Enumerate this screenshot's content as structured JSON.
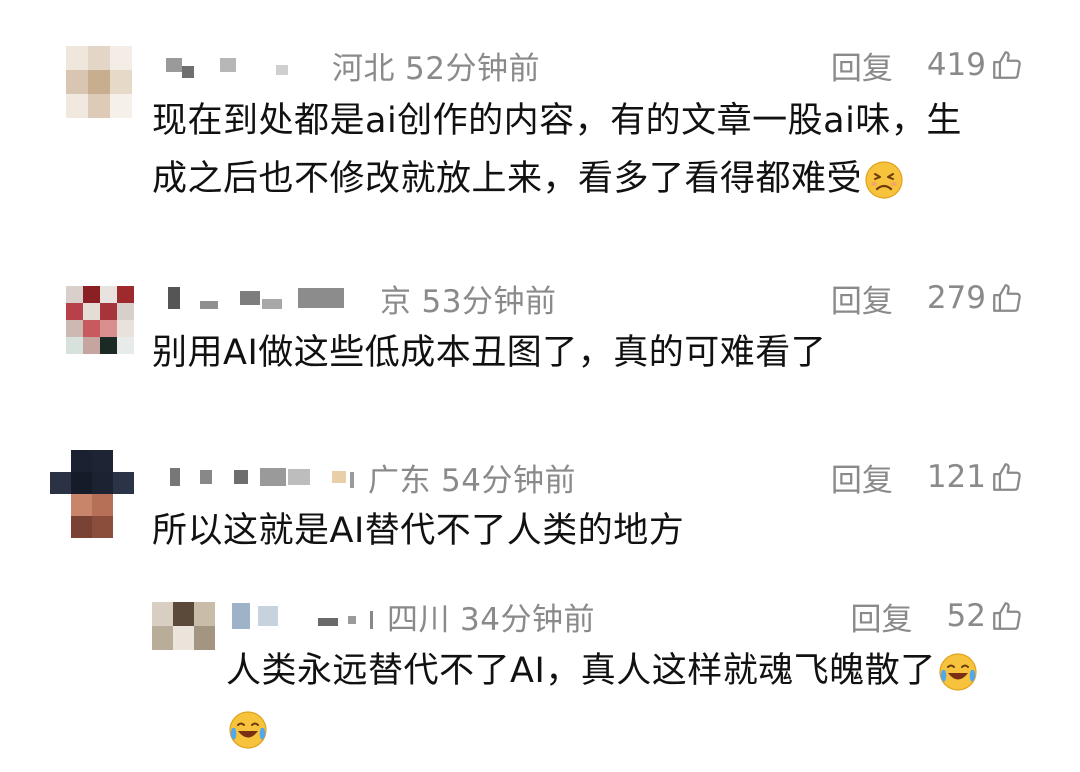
{
  "colors": {
    "meta_gray": "#8a8a8a",
    "text": "#111111",
    "background": "#ffffff"
  },
  "comments": [
    {
      "location": "河北",
      "time": "52分钟前",
      "reply_label": "回复",
      "likes": "419",
      "like_icon": "thumbs-up-icon",
      "text_line1": "现在到处都是ai创作的内容，有的文章一股ai味，生",
      "text_line2": "成之后也不修改就放上来，看多了看得都难受",
      "emoji": "tired-face-emoji"
    },
    {
      "location": "京",
      "time": "53分钟前",
      "reply_label": "回复",
      "likes": "279",
      "like_icon": "thumbs-up-icon",
      "text_line1": "别用AI做这些低成本丑图了，真的可难看了"
    },
    {
      "location": "广东",
      "time": "54分钟前",
      "reply_label": "回复",
      "likes": "121",
      "like_icon": "thumbs-up-icon",
      "text_line1": "所以这就是AI替代不了人类的地方"
    },
    {
      "location": "四川",
      "time": "34分钟前",
      "reply_label": "回复",
      "likes": "52",
      "like_icon": "thumbs-up-icon",
      "text_line1": "人类永远替代不了AI，真人这样就魂飞魄散了",
      "emoji": "laughing-crying-emoji"
    }
  ]
}
